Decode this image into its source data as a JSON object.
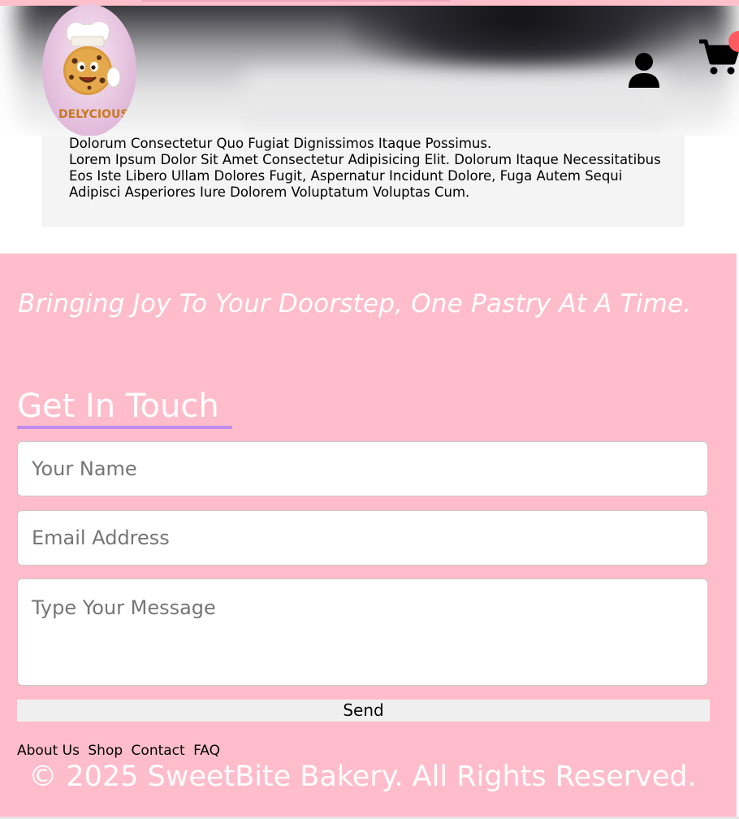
{
  "header": {
    "logo_text": "DELYCIOUS"
  },
  "about": {
    "paragraphs": [
      "Dolorum Consectetur Quo Fugiat Dignissimos Itaque Possimus.",
      "Lorem Ipsum Dolor Sit Amet Consectetur Adipisicing Elit. Dolorum Itaque Necessitatibus Eos Iste Libero Ullam Dolores Fugit, Aspernatur Incidunt Dolore, Fuga Autem Sequi Adipisci Asperiores Iure Dolorem Voluptatum Voluptas Cum."
    ]
  },
  "tagline": "Bringing Joy To Your Doorstep, One Pastry At A Time.",
  "contact": {
    "title": "Get In Touch",
    "name_placeholder": "Your Name",
    "email_placeholder": "Email Address",
    "message_placeholder": "Type Your Message",
    "send_label": "Send"
  },
  "footer": {
    "links": [
      "About Us",
      "Shop",
      "Contact",
      "FAQ"
    ],
    "copyright": "© 2025 SweetBite Bakery. All Rights Reserved."
  },
  "icons": {
    "user": "user-icon",
    "cart": "cart-icon"
  },
  "colors": {
    "pink_background": "#ffbdcc",
    "accent_underline": "#c08cf0",
    "cart_badge": "#ff5a5f",
    "about_background": "#f4f4f4"
  }
}
